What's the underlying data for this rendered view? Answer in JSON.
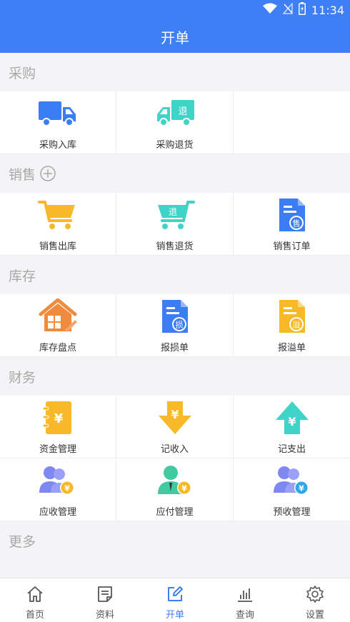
{
  "status": {
    "time": "11:34"
  },
  "header": {
    "title": "开单"
  },
  "sections": [
    {
      "title": "采购",
      "items": [
        {
          "label": "采购入库",
          "icon": "truck-icon"
        },
        {
          "label": "采购退货",
          "icon": "return-truck-icon",
          "badge": "退"
        }
      ]
    },
    {
      "title": "销售",
      "items": [
        {
          "label": "销售出库",
          "icon": "cart-icon"
        },
        {
          "label": "销售退货",
          "icon": "return-cart-icon",
          "badge": "退"
        },
        {
          "label": "销售订单",
          "icon": "order-doc-icon",
          "badge": "售"
        }
      ]
    },
    {
      "title": "库存",
      "items": [
        {
          "label": "库存盘点",
          "icon": "warehouse-icon"
        },
        {
          "label": "报损单",
          "icon": "loss-doc-icon",
          "badge": "损"
        },
        {
          "label": "报溢单",
          "icon": "overflow-doc-icon",
          "badge": "溢"
        }
      ]
    },
    {
      "title": "财务",
      "items": [
        {
          "label": "资金管理",
          "icon": "fund-book-icon",
          "badge": "¥"
        },
        {
          "label": "记收入",
          "icon": "income-arrow-icon",
          "badge": "¥"
        },
        {
          "label": "记支出",
          "icon": "expense-arrow-icon",
          "badge": "¥"
        },
        {
          "label": "应收管理",
          "icon": "receivable-people-icon",
          "badge": "¥"
        },
        {
          "label": "应付管理",
          "icon": "payable-person-icon",
          "badge": "¥"
        },
        {
          "label": "预收管理",
          "icon": "prepaid-people-icon",
          "badge": "¥"
        }
      ]
    },
    {
      "title": "更多",
      "items": []
    }
  ],
  "tabs": [
    {
      "label": "首页",
      "icon": "home-icon"
    },
    {
      "label": "资料",
      "icon": "document-icon"
    },
    {
      "label": "开单",
      "icon": "edit-icon",
      "active": true
    },
    {
      "label": "查询",
      "icon": "bar-chart-icon"
    },
    {
      "label": "设置",
      "icon": "gear-icon"
    }
  ],
  "colors": {
    "brand": "#3f7ff5",
    "blue": "#3b7ef4",
    "teal": "#3fd4c8",
    "yellow": "#f7b927",
    "orange": "#f08a3c",
    "purple": "#7f87f0",
    "green": "#41c9a0"
  }
}
